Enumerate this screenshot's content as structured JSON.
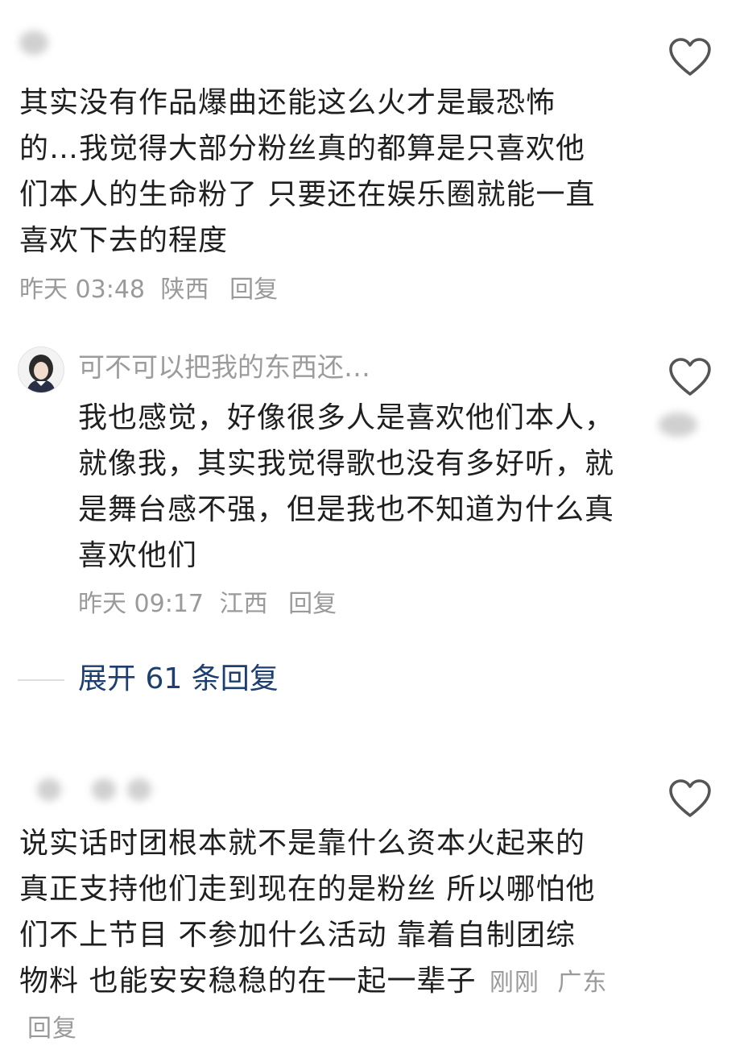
{
  "comment1": {
    "text": "其实没有作品爆曲还能这么火才是最恐怖的…我觉得大部分粉丝真的都算是只喜欢他们本人的生命粉了 只要还在娱乐圈就能一直喜欢下去的程度",
    "time": "昨天 03:48",
    "location": "陕西",
    "reply_label": "回复"
  },
  "reply1": {
    "username": "可不可以把我的东西还…",
    "text": "我也感觉，好像很多人是喜欢他们本人，就像我，其实我觉得歌也没有多好听，就是舞台感不强，但是我也不知道为什么真喜欢他们",
    "time": "昨天 09:17",
    "location": "江西",
    "reply_label": "回复"
  },
  "expand_replies": {
    "label": "展开 61 条回复"
  },
  "comment2": {
    "text": "说实话时团根本就不是靠什么资本火起来的 真正支持他们走到现在的是粉丝 所以哪怕他们不上节目 不参加什么活动 靠着自制团综 物料 也能安安稳稳的在一起一辈子",
    "time": "刚刚",
    "location": "广东",
    "reply_label": "回复"
  },
  "icons": {
    "like": "heart-outline-icon",
    "avatar": "user-avatar"
  },
  "colors": {
    "text": "#1f1f1f",
    "meta": "#9a9a9a",
    "link": "#1d3f70"
  }
}
